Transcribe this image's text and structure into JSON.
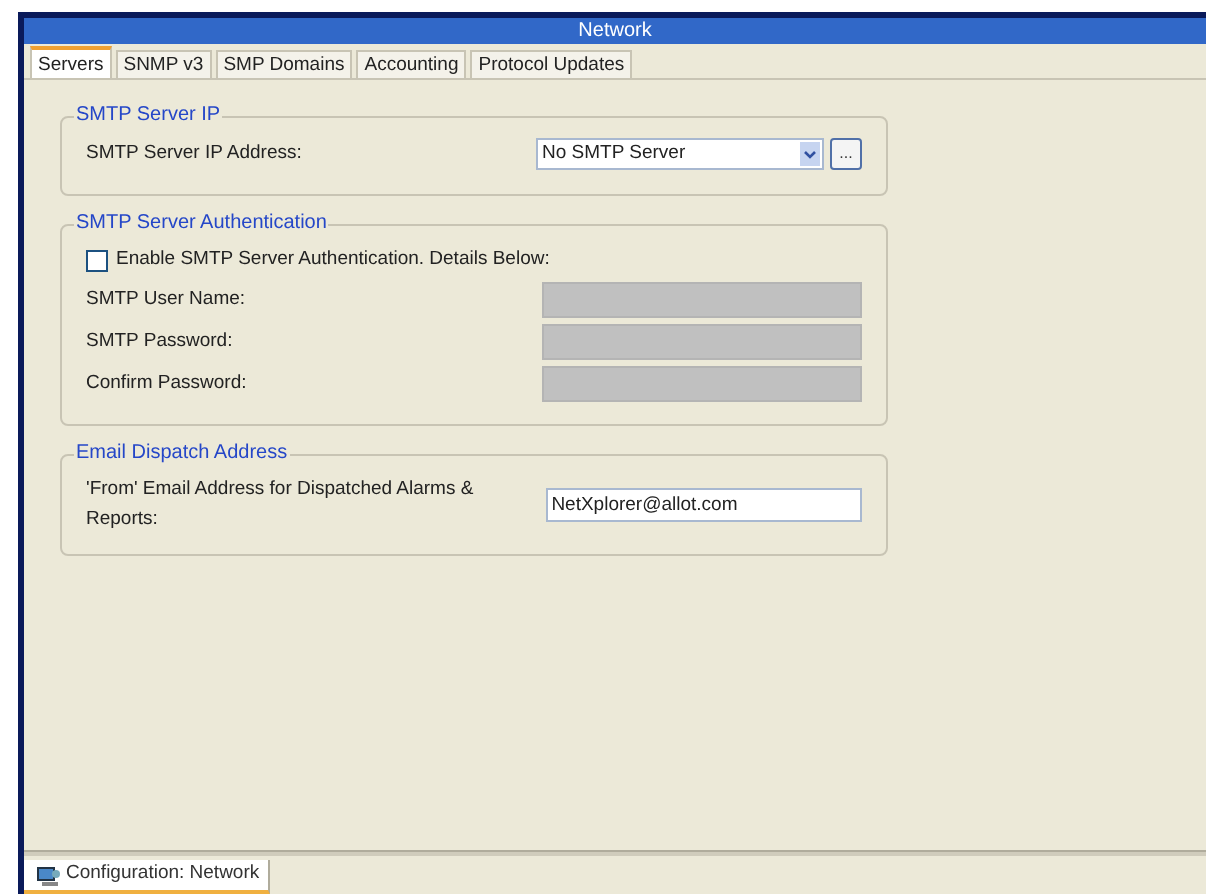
{
  "window": {
    "title": "Network"
  },
  "tabs": [
    {
      "label": "Servers",
      "selected": true
    },
    {
      "label": "SNMP v3",
      "selected": false
    },
    {
      "label": "SMP Domains",
      "selected": false
    },
    {
      "label": "Accounting",
      "selected": false
    },
    {
      "label": "Protocol Updates",
      "selected": false
    }
  ],
  "smtp_server_ip": {
    "legend": "SMTP Server IP",
    "label": "SMTP Server IP Address:",
    "value": "No SMTP Server",
    "browse": "..."
  },
  "smtp_auth": {
    "legend": "SMTP Server Authentication",
    "checkbox": {
      "label": "Enable SMTP Server Authentication. Details Below:",
      "checked": false
    },
    "fields": [
      {
        "label": "SMTP User Name:",
        "disabled": true
      },
      {
        "label": "SMTP Password:",
        "disabled": true
      },
      {
        "label": "Confirm Password:",
        "disabled": true
      }
    ]
  },
  "email_dispatch": {
    "legend": "Email Dispatch Address",
    "label": "'From' Email Address for Dispatched Alarms & Reports:",
    "value": "NetXplorer@allot.com"
  },
  "bottom_tabs": [
    {
      "label": "Configuration: Network",
      "selected": true
    }
  ]
}
